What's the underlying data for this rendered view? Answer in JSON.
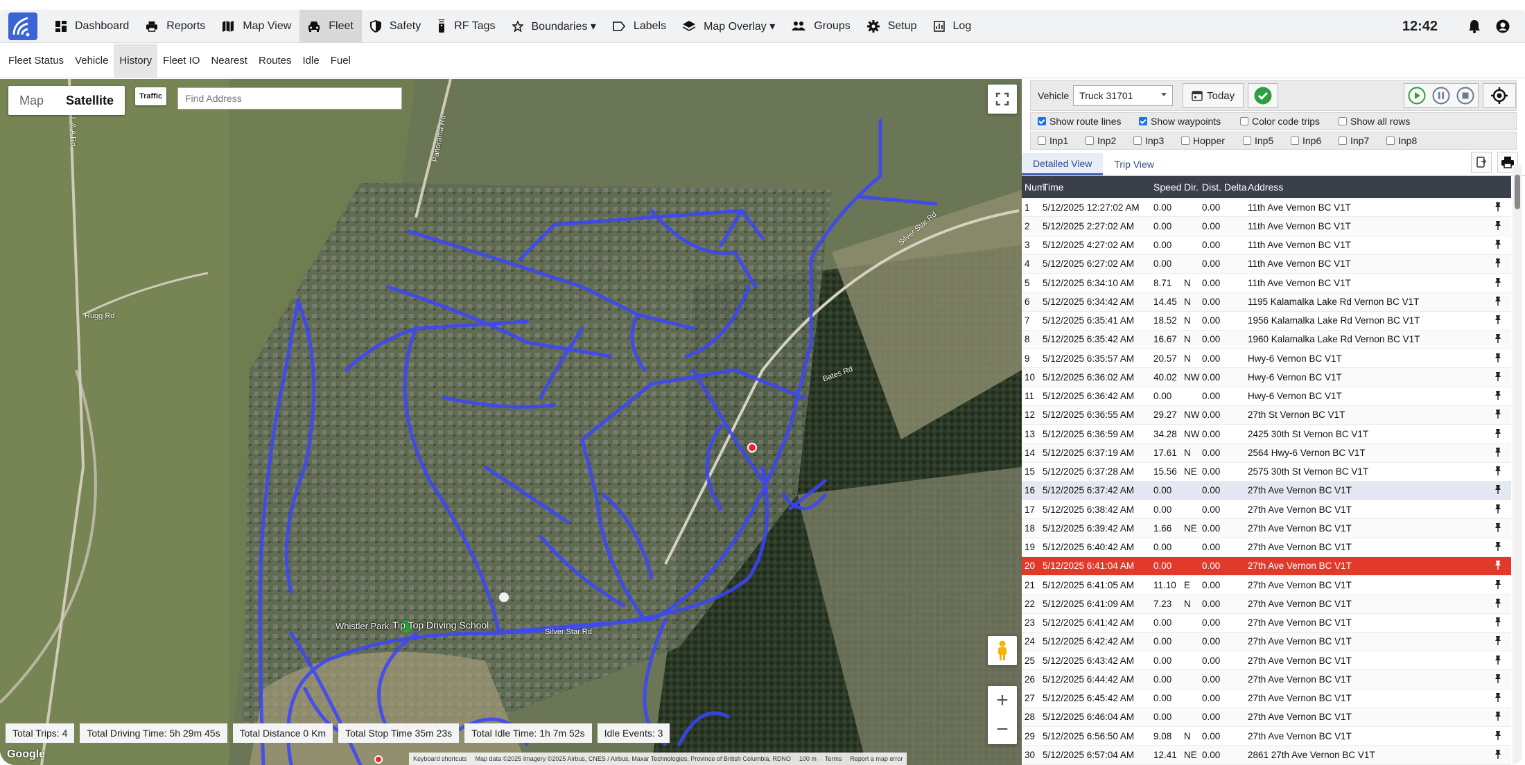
{
  "topnav": {
    "items": [
      {
        "label": "Dashboard",
        "icon": "dashboard-icon"
      },
      {
        "label": "Reports",
        "icon": "printer-icon"
      },
      {
        "label": "Map View",
        "icon": "map-icon"
      },
      {
        "label": "Fleet",
        "icon": "car-icon",
        "active": true
      },
      {
        "label": "Safety",
        "icon": "shield-icon"
      },
      {
        "label": "RF Tags",
        "icon": "rf-tag-icon"
      },
      {
        "label": "Boundaries ▾",
        "icon": "star-icon"
      },
      {
        "label": "Labels",
        "icon": "label-icon"
      },
      {
        "label": "Map Overlay ▾",
        "icon": "layers-icon"
      },
      {
        "label": "Groups",
        "icon": "users-icon"
      },
      {
        "label": "Setup",
        "icon": "gear-icon"
      },
      {
        "label": "Log",
        "icon": "log-icon"
      }
    ],
    "clock": "12:42"
  },
  "subnav": {
    "items": [
      {
        "label": "Fleet Status"
      },
      {
        "label": "Vehicle"
      },
      {
        "label": "History",
        "active": true
      },
      {
        "label": "Fleet IO"
      },
      {
        "label": "Nearest"
      },
      {
        "label": "Routes"
      },
      {
        "label": "Idle"
      },
      {
        "label": "Fuel"
      }
    ]
  },
  "map": {
    "type_map": "Map",
    "type_satellite": "Satellite",
    "traffic": "Traffic",
    "find_address_placeholder": "Find Address",
    "labels": {
      "tip_top": "Tip Top Driving School",
      "whistler_park": "Whistler Park",
      "silver_star_rd": "Silver Star Rd",
      "rugg_rd": "Rugg Rd",
      "panorama_rd": "Panorama Rd",
      "l_a_rd": "L & A Rd",
      "silver_star_rd_2": "Silver Star Rd",
      "bates_rd": "Bates Rd",
      "google": "Google"
    },
    "stats": [
      "Total Trips: 4",
      "Total Driving Time: 5h 29m 45s",
      "Total Distance 0 Km",
      "Total Stop Time 35m 23s",
      "Total Idle Time: 1h 7m 52s",
      "Idle Events: 3"
    ],
    "attribution": {
      "shortcuts": "Keyboard shortcuts",
      "data": "Map data ©2025 Imagery ©2025 Airbus, CNES / Airbus, Maxar Technologies, Province of British Columbia, RDNO",
      "scale": "100 m",
      "terms": "Terms",
      "report": "Report a map error"
    }
  },
  "panel": {
    "vehicle_label": "Vehicle",
    "vehicle_value": "Truck 31701",
    "today": "Today",
    "options_row1": [
      {
        "label": "Show route lines",
        "checked": true
      },
      {
        "label": "Show waypoints",
        "checked": true
      },
      {
        "label": "Color code trips",
        "checked": false
      },
      {
        "label": "Show all rows",
        "checked": false
      }
    ],
    "options_row2": [
      {
        "label": "Inp1"
      },
      {
        "label": "Inp2"
      },
      {
        "label": "Inp3"
      },
      {
        "label": "Hopper"
      },
      {
        "label": "Inp5"
      },
      {
        "label": "Inp6"
      },
      {
        "label": "Inp7"
      },
      {
        "label": "Inp8"
      }
    ],
    "tabs": [
      "Detailed View",
      "Trip View"
    ],
    "columns": [
      "Num",
      "Time",
      "Speed",
      "Dir.",
      "Dist. Delta",
      "Address"
    ],
    "rows": [
      {
        "num": "1",
        "time": "5/12/2025 12:27:02 AM",
        "speed": "0.00",
        "dir": "",
        "dd": "0.00",
        "addr": "11th Ave Vernon BC V1T"
      },
      {
        "num": "2",
        "time": "5/12/2025 2:27:02 AM",
        "speed": "0.00",
        "dir": "",
        "dd": "0.00",
        "addr": "11th Ave Vernon BC V1T"
      },
      {
        "num": "3",
        "time": "5/12/2025 4:27:02 AM",
        "speed": "0.00",
        "dir": "",
        "dd": "0.00",
        "addr": "11th Ave Vernon BC V1T"
      },
      {
        "num": "4",
        "time": "5/12/2025 6:27:02 AM",
        "speed": "0.00",
        "dir": "",
        "dd": "0.00",
        "addr": "11th Ave Vernon BC V1T"
      },
      {
        "num": "5",
        "time": "5/12/2025 6:34:10 AM",
        "speed": "8.71",
        "dir": "N",
        "dd": "0.00",
        "addr": "11th Ave Vernon BC V1T"
      },
      {
        "num": "6",
        "time": "5/12/2025 6:34:42 AM",
        "speed": "14.45",
        "dir": "N",
        "dd": "0.00",
        "addr": "1195 Kalamalka Lake Rd Vernon BC V1T"
      },
      {
        "num": "7",
        "time": "5/12/2025 6:35:41 AM",
        "speed": "18.52",
        "dir": "N",
        "dd": "0.00",
        "addr": "1956 Kalamalka Lake Rd Vernon BC V1T"
      },
      {
        "num": "8",
        "time": "5/12/2025 6:35:42 AM",
        "speed": "16.67",
        "dir": "N",
        "dd": "0.00",
        "addr": "1960 Kalamalka Lake Rd Vernon BC V1T"
      },
      {
        "num": "9",
        "time": "5/12/2025 6:35:57 AM",
        "speed": "20.57",
        "dir": "N",
        "dd": "0.00",
        "addr": "Hwy-6 Vernon BC V1T"
      },
      {
        "num": "10",
        "time": "5/12/2025 6:36:02 AM",
        "speed": "40.02",
        "dir": "NW",
        "dd": "0.00",
        "addr": "Hwy-6 Vernon BC V1T"
      },
      {
        "num": "11",
        "time": "5/12/2025 6:36:42 AM",
        "speed": "0.00",
        "dir": "",
        "dd": "0.00",
        "addr": "Hwy-6 Vernon BC V1T"
      },
      {
        "num": "12",
        "time": "5/12/2025 6:36:55 AM",
        "speed": "29.27",
        "dir": "NW",
        "dd": "0.00",
        "addr": "27th St Vernon BC V1T"
      },
      {
        "num": "13",
        "time": "5/12/2025 6:36:59 AM",
        "speed": "34.28",
        "dir": "NW",
        "dd": "0.00",
        "addr": "2425 30th St Vernon BC V1T"
      },
      {
        "num": "14",
        "time": "5/12/2025 6:37:19 AM",
        "speed": "17.61",
        "dir": "N",
        "dd": "0.00",
        "addr": "2564 Hwy-6 Vernon BC V1T"
      },
      {
        "num": "15",
        "time": "5/12/2025 6:37:28 AM",
        "speed": "15.56",
        "dir": "NE",
        "dd": "0.00",
        "addr": "2575 30th St Vernon BC V1T"
      },
      {
        "num": "16",
        "time": "5/12/2025 6:37:42 AM",
        "speed": "0.00",
        "dir": "",
        "dd": "0.00",
        "addr": "27th Ave Vernon BC V1T",
        "hl": true
      },
      {
        "num": "17",
        "time": "5/12/2025 6:38:42 AM",
        "speed": "0.00",
        "dir": "",
        "dd": "0.00",
        "addr": "27th Ave Vernon BC V1T"
      },
      {
        "num": "18",
        "time": "5/12/2025 6:39:42 AM",
        "speed": "1.66",
        "dir": "NE",
        "dd": "0.00",
        "addr": "27th Ave Vernon BC V1T"
      },
      {
        "num": "19",
        "time": "5/12/2025 6:40:42 AM",
        "speed": "0.00",
        "dir": "",
        "dd": "0.00",
        "addr": "27th Ave Vernon BC V1T"
      },
      {
        "num": "20",
        "time": "5/12/2025 6:41:04 AM",
        "speed": "0.00",
        "dir": "",
        "dd": "0.00",
        "addr": "27th Ave Vernon BC V1T",
        "red": true
      },
      {
        "num": "21",
        "time": "5/12/2025 6:41:05 AM",
        "speed": "11.10",
        "dir": "E",
        "dd": "0.00",
        "addr": "27th Ave Vernon BC V1T"
      },
      {
        "num": "22",
        "time": "5/12/2025 6:41:09 AM",
        "speed": "7.23",
        "dir": "N",
        "dd": "0.00",
        "addr": "27th Ave Vernon BC V1T"
      },
      {
        "num": "23",
        "time": "5/12/2025 6:41:42 AM",
        "speed": "0.00",
        "dir": "",
        "dd": "0.00",
        "addr": "27th Ave Vernon BC V1T"
      },
      {
        "num": "24",
        "time": "5/12/2025 6:42:42 AM",
        "speed": "0.00",
        "dir": "",
        "dd": "0.00",
        "addr": "27th Ave Vernon BC V1T"
      },
      {
        "num": "25",
        "time": "5/12/2025 6:43:42 AM",
        "speed": "0.00",
        "dir": "",
        "dd": "0.00",
        "addr": "27th Ave Vernon BC V1T"
      },
      {
        "num": "26",
        "time": "5/12/2025 6:44:42 AM",
        "speed": "0.00",
        "dir": "",
        "dd": "0.00",
        "addr": "27th Ave Vernon BC V1T"
      },
      {
        "num": "27",
        "time": "5/12/2025 6:45:42 AM",
        "speed": "0.00",
        "dir": "",
        "dd": "0.00",
        "addr": "27th Ave Vernon BC V1T"
      },
      {
        "num": "28",
        "time": "5/12/2025 6:46:04 AM",
        "speed": "0.00",
        "dir": "",
        "dd": "0.00",
        "addr": "27th Ave Vernon BC V1T"
      },
      {
        "num": "29",
        "time": "5/12/2025 6:56:50 AM",
        "speed": "9.08",
        "dir": "N",
        "dd": "0.00",
        "addr": "27th Ave Vernon BC V1T"
      },
      {
        "num": "30",
        "time": "5/12/2025 6:57:04 AM",
        "speed": "12.41",
        "dir": "NE",
        "dd": "0.00",
        "addr": "2861 27th Ave Vernon BC V1T"
      }
    ]
  },
  "colors": {
    "route": "#3b45ff",
    "highlight_row": "#e13a2b",
    "header": "#3a3f4a",
    "accent": "#2e9e3f"
  }
}
